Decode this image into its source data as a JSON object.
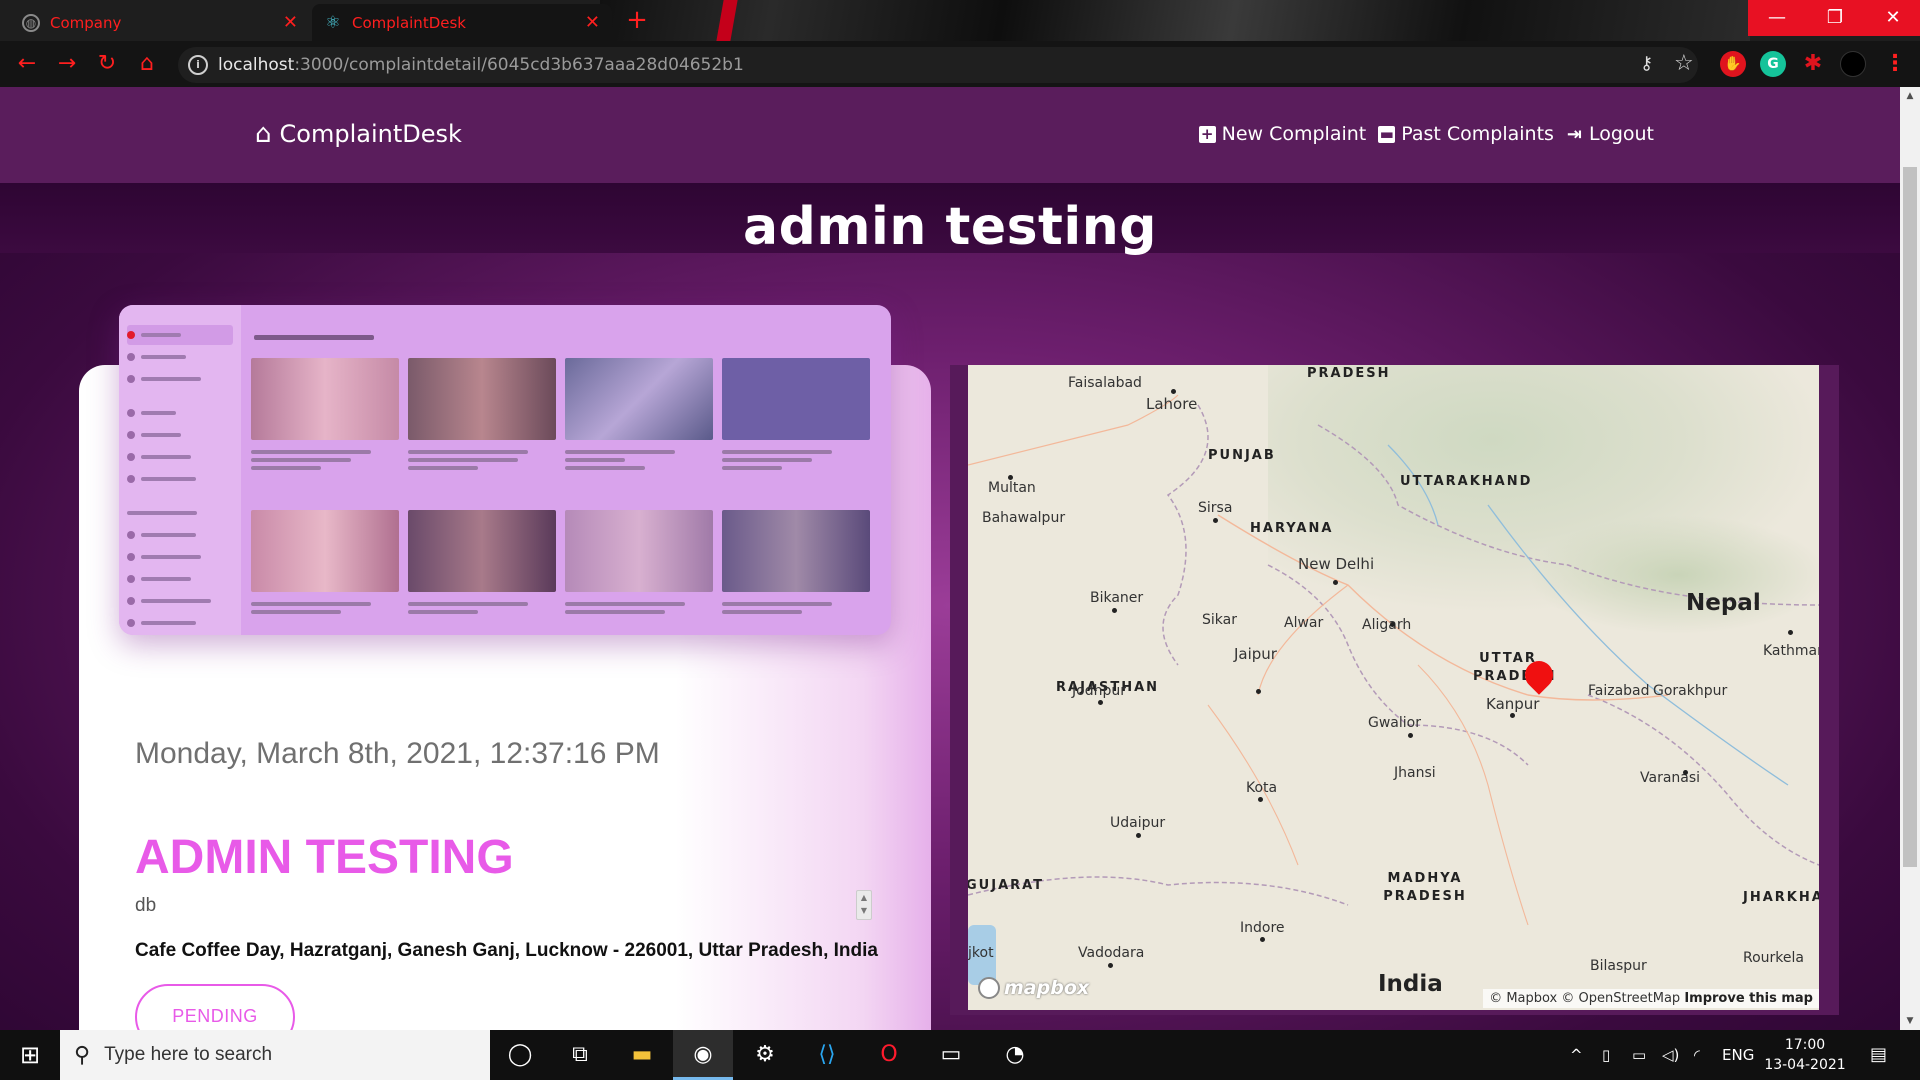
{
  "browser": {
    "tabs": [
      {
        "title": "Company",
        "icon": "globe-icon"
      },
      {
        "title": "ComplaintDesk",
        "icon": "react-icon"
      }
    ],
    "new_tab": "+",
    "url_host": "localhost",
    "url_path": ":3000/complaintdetail/6045cd3b637aaa28d04652b1",
    "window_controls": {
      "minimize": "—",
      "maximize": "❐",
      "close": "✕"
    }
  },
  "navbar": {
    "brand": "ComplaintDesk",
    "links": [
      {
        "label": "New Complaint",
        "icon": "plus-square-icon"
      },
      {
        "label": "Past Complaints",
        "icon": "archive-icon"
      },
      {
        "label": "Logout",
        "icon": "logout-icon"
      }
    ]
  },
  "page_title": "admin testing",
  "complaint": {
    "date": "Monday, March 8th, 2021, 12:37:16 PM",
    "title": "ADMIN TESTING",
    "description": "db",
    "address": "Cafe Coffee Day, Hazratganj, Ganesh Ganj, Lucknow - 226001, Uttar Pradesh, India",
    "status": "PENDING"
  },
  "map": {
    "countries": [
      "Nepal",
      "India"
    ],
    "states": [
      "PRADESH",
      "PUNJAB",
      "UTTARAKHAND",
      "HARYANA",
      "RAJASTHAN",
      "UTTAR PRADESH",
      "GUJARAT",
      "MADHYA PRADESH",
      "JHARKHAN"
    ],
    "cities": [
      "Faisalabad",
      "Lahore",
      "Multan",
      "Bahawalpur",
      "Sirsa",
      "New Delhi",
      "Bikaner",
      "Sikar",
      "Alwar",
      "Aligarh",
      "Jaipur",
      "Jodhpur",
      "Kanpur",
      "Faizabad",
      "Gorakhpur",
      "Kathman",
      "Gwalior",
      "Jhansi",
      "Varanasi",
      "Kota",
      "Udaipur",
      "Indore",
      "Vadodara",
      "Bilaspur",
      "Rourkela",
      "jkot"
    ],
    "logo": "mapbox",
    "attribution": "© Mapbox © OpenStreetMap",
    "improve": "Improve this map",
    "marker_color": "#f01010"
  },
  "taskbar": {
    "search_placeholder": "Type here to search",
    "language": "ENG",
    "time": "17:00",
    "date": "13-04-2021"
  },
  "colors": {
    "accent": "#e85ae8",
    "navbar": "#5a1d5c",
    "browser_accent": "#ff1f1f"
  }
}
